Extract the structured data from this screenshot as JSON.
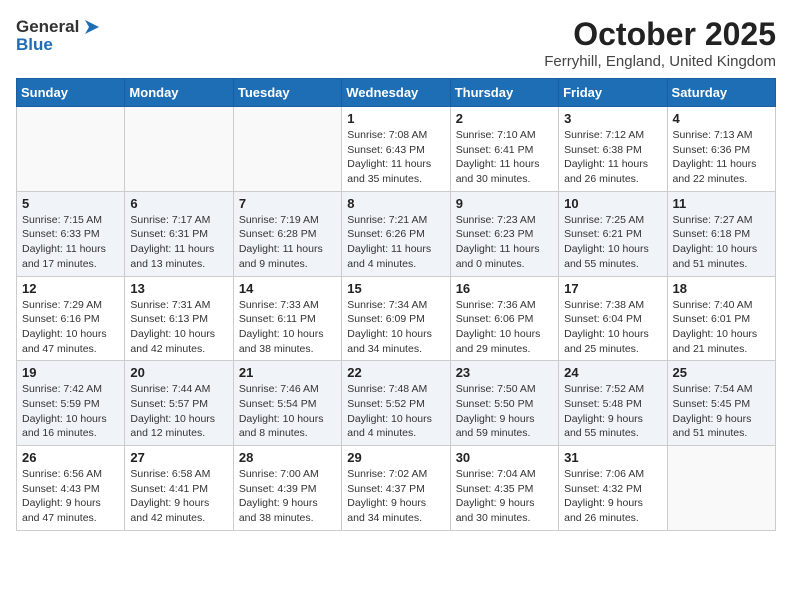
{
  "header": {
    "logo_general": "General",
    "logo_blue": "Blue",
    "title": "October 2025",
    "location": "Ferryhill, England, United Kingdom"
  },
  "days_of_week": [
    "Sunday",
    "Monday",
    "Tuesday",
    "Wednesday",
    "Thursday",
    "Friday",
    "Saturday"
  ],
  "weeks": [
    [
      {
        "day": "",
        "sunrise": "",
        "sunset": "",
        "daylight": ""
      },
      {
        "day": "",
        "sunrise": "",
        "sunset": "",
        "daylight": ""
      },
      {
        "day": "",
        "sunrise": "",
        "sunset": "",
        "daylight": ""
      },
      {
        "day": "1",
        "sunrise": "Sunrise: 7:08 AM",
        "sunset": "Sunset: 6:43 PM",
        "daylight": "Daylight: 11 hours and 35 minutes."
      },
      {
        "day": "2",
        "sunrise": "Sunrise: 7:10 AM",
        "sunset": "Sunset: 6:41 PM",
        "daylight": "Daylight: 11 hours and 30 minutes."
      },
      {
        "day": "3",
        "sunrise": "Sunrise: 7:12 AM",
        "sunset": "Sunset: 6:38 PM",
        "daylight": "Daylight: 11 hours and 26 minutes."
      },
      {
        "day": "4",
        "sunrise": "Sunrise: 7:13 AM",
        "sunset": "Sunset: 6:36 PM",
        "daylight": "Daylight: 11 hours and 22 minutes."
      }
    ],
    [
      {
        "day": "5",
        "sunrise": "Sunrise: 7:15 AM",
        "sunset": "Sunset: 6:33 PM",
        "daylight": "Daylight: 11 hours and 17 minutes."
      },
      {
        "day": "6",
        "sunrise": "Sunrise: 7:17 AM",
        "sunset": "Sunset: 6:31 PM",
        "daylight": "Daylight: 11 hours and 13 minutes."
      },
      {
        "day": "7",
        "sunrise": "Sunrise: 7:19 AM",
        "sunset": "Sunset: 6:28 PM",
        "daylight": "Daylight: 11 hours and 9 minutes."
      },
      {
        "day": "8",
        "sunrise": "Sunrise: 7:21 AM",
        "sunset": "Sunset: 6:26 PM",
        "daylight": "Daylight: 11 hours and 4 minutes."
      },
      {
        "day": "9",
        "sunrise": "Sunrise: 7:23 AM",
        "sunset": "Sunset: 6:23 PM",
        "daylight": "Daylight: 11 hours and 0 minutes."
      },
      {
        "day": "10",
        "sunrise": "Sunrise: 7:25 AM",
        "sunset": "Sunset: 6:21 PM",
        "daylight": "Daylight: 10 hours and 55 minutes."
      },
      {
        "day": "11",
        "sunrise": "Sunrise: 7:27 AM",
        "sunset": "Sunset: 6:18 PM",
        "daylight": "Daylight: 10 hours and 51 minutes."
      }
    ],
    [
      {
        "day": "12",
        "sunrise": "Sunrise: 7:29 AM",
        "sunset": "Sunset: 6:16 PM",
        "daylight": "Daylight: 10 hours and 47 minutes."
      },
      {
        "day": "13",
        "sunrise": "Sunrise: 7:31 AM",
        "sunset": "Sunset: 6:13 PM",
        "daylight": "Daylight: 10 hours and 42 minutes."
      },
      {
        "day": "14",
        "sunrise": "Sunrise: 7:33 AM",
        "sunset": "Sunset: 6:11 PM",
        "daylight": "Daylight: 10 hours and 38 minutes."
      },
      {
        "day": "15",
        "sunrise": "Sunrise: 7:34 AM",
        "sunset": "Sunset: 6:09 PM",
        "daylight": "Daylight: 10 hours and 34 minutes."
      },
      {
        "day": "16",
        "sunrise": "Sunrise: 7:36 AM",
        "sunset": "Sunset: 6:06 PM",
        "daylight": "Daylight: 10 hours and 29 minutes."
      },
      {
        "day": "17",
        "sunrise": "Sunrise: 7:38 AM",
        "sunset": "Sunset: 6:04 PM",
        "daylight": "Daylight: 10 hours and 25 minutes."
      },
      {
        "day": "18",
        "sunrise": "Sunrise: 7:40 AM",
        "sunset": "Sunset: 6:01 PM",
        "daylight": "Daylight: 10 hours and 21 minutes."
      }
    ],
    [
      {
        "day": "19",
        "sunrise": "Sunrise: 7:42 AM",
        "sunset": "Sunset: 5:59 PM",
        "daylight": "Daylight: 10 hours and 16 minutes."
      },
      {
        "day": "20",
        "sunrise": "Sunrise: 7:44 AM",
        "sunset": "Sunset: 5:57 PM",
        "daylight": "Daylight: 10 hours and 12 minutes."
      },
      {
        "day": "21",
        "sunrise": "Sunrise: 7:46 AM",
        "sunset": "Sunset: 5:54 PM",
        "daylight": "Daylight: 10 hours and 8 minutes."
      },
      {
        "day": "22",
        "sunrise": "Sunrise: 7:48 AM",
        "sunset": "Sunset: 5:52 PM",
        "daylight": "Daylight: 10 hours and 4 minutes."
      },
      {
        "day": "23",
        "sunrise": "Sunrise: 7:50 AM",
        "sunset": "Sunset: 5:50 PM",
        "daylight": "Daylight: 9 hours and 59 minutes."
      },
      {
        "day": "24",
        "sunrise": "Sunrise: 7:52 AM",
        "sunset": "Sunset: 5:48 PM",
        "daylight": "Daylight: 9 hours and 55 minutes."
      },
      {
        "day": "25",
        "sunrise": "Sunrise: 7:54 AM",
        "sunset": "Sunset: 5:45 PM",
        "daylight": "Daylight: 9 hours and 51 minutes."
      }
    ],
    [
      {
        "day": "26",
        "sunrise": "Sunrise: 6:56 AM",
        "sunset": "Sunset: 4:43 PM",
        "daylight": "Daylight: 9 hours and 47 minutes."
      },
      {
        "day": "27",
        "sunrise": "Sunrise: 6:58 AM",
        "sunset": "Sunset: 4:41 PM",
        "daylight": "Daylight: 9 hours and 42 minutes."
      },
      {
        "day": "28",
        "sunrise": "Sunrise: 7:00 AM",
        "sunset": "Sunset: 4:39 PM",
        "daylight": "Daylight: 9 hours and 38 minutes."
      },
      {
        "day": "29",
        "sunrise": "Sunrise: 7:02 AM",
        "sunset": "Sunset: 4:37 PM",
        "daylight": "Daylight: 9 hours and 34 minutes."
      },
      {
        "day": "30",
        "sunrise": "Sunrise: 7:04 AM",
        "sunset": "Sunset: 4:35 PM",
        "daylight": "Daylight: 9 hours and 30 minutes."
      },
      {
        "day": "31",
        "sunrise": "Sunrise: 7:06 AM",
        "sunset": "Sunset: 4:32 PM",
        "daylight": "Daylight: 9 hours and 26 minutes."
      },
      {
        "day": "",
        "sunrise": "",
        "sunset": "",
        "daylight": ""
      }
    ]
  ]
}
